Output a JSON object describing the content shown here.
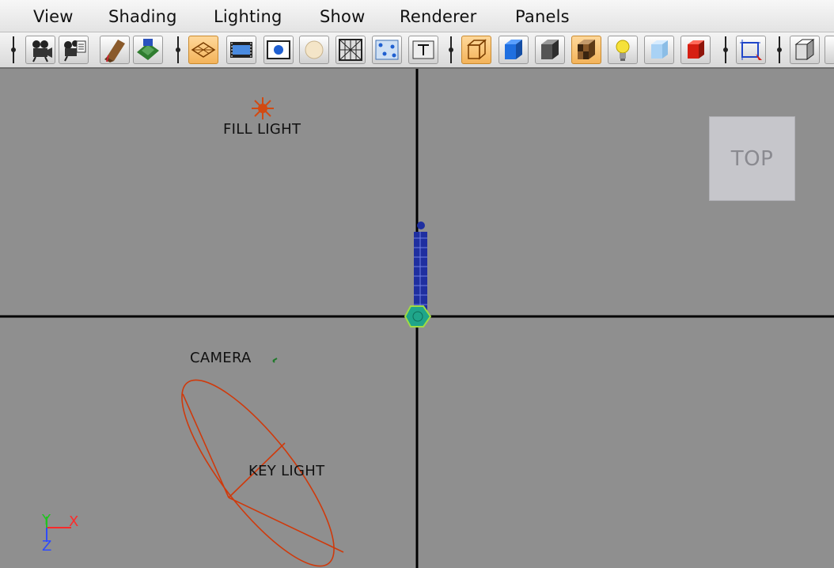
{
  "menu": {
    "view": "View",
    "shading": "Shading",
    "lighting": "Lighting",
    "show": "Show",
    "renderer": "Renderer",
    "panels": "Panels"
  },
  "toolbar": {
    "icons": [
      "camera-select-icon",
      "camera-attributes-icon",
      "bookmark-icon",
      "image-plane-icon",
      "grid-icon",
      "film-gate-icon",
      "resolution-gate-icon",
      "field-chart-icon",
      "wireframe-icon",
      "uv-texture-icon",
      "text-icon",
      "xray-icon",
      "smooth-shade-icon",
      "shade-all-icon",
      "textured-icon",
      "lights-icon",
      "shadows-icon",
      "isolate-icon",
      "frame-selection-icon",
      "display-layers-icon"
    ],
    "active_icons": [
      "grid-icon",
      "xray-icon",
      "textured-icon"
    ]
  },
  "viewport": {
    "view_name": "TOP",
    "labels": {
      "fill_light": "FILL LIGHT",
      "camera": "CAMERA",
      "key_light": "KEY LIGHT"
    },
    "axis": {
      "x": "X",
      "y": "Y",
      "z": "Z"
    },
    "colors": {
      "background": "#8f8f8f",
      "light_icon": "#c2410c",
      "mesh": "#1f2fa0",
      "selection": "#20b08a",
      "axis_x": "#ff2a2a",
      "axis_y": "#22c322",
      "axis_z": "#2e4bff"
    }
  }
}
